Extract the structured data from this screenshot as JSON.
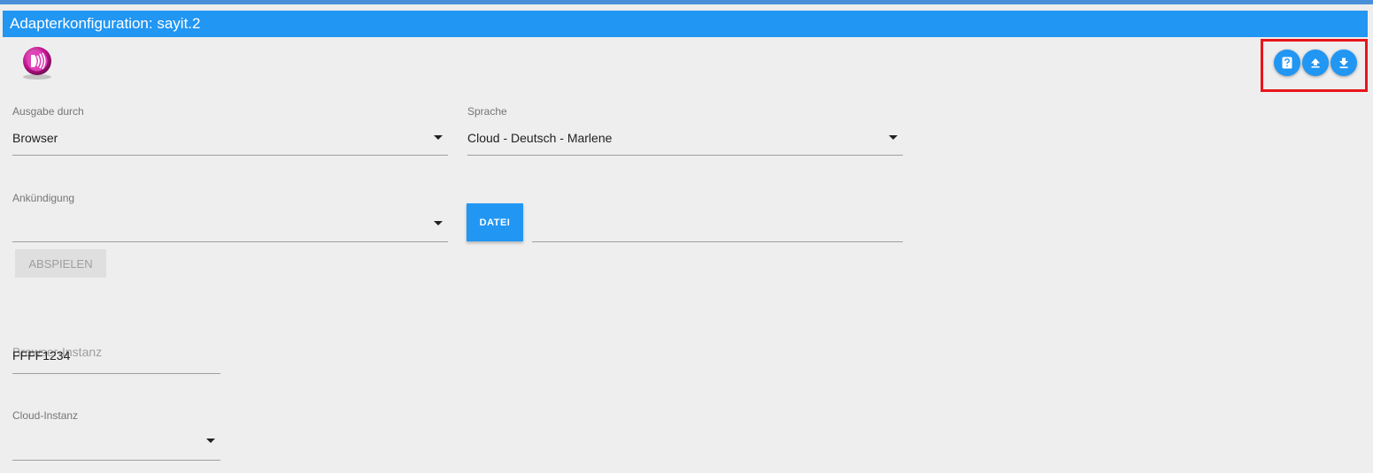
{
  "window": {
    "title": "Adapterkonfiguration: sayit.2"
  },
  "toolbar": {
    "buttons": [
      {
        "icon": "help-icon",
        "label": ""
      },
      {
        "icon": "upload-icon",
        "label": ""
      },
      {
        "icon": "download-icon",
        "label": ""
      }
    ],
    "highlight_color": "#e8151b"
  },
  "form": {
    "output": {
      "label": "Ausgabe durch",
      "value": "Browser"
    },
    "language": {
      "label": "Sprache",
      "value": "Cloud - Deutsch - Marlene"
    },
    "announcement": {
      "label": "Ankündigung",
      "value": "",
      "file_button": "DATEI",
      "file_value": ""
    },
    "play_button": "ABSPIELEN",
    "browser_instance": {
      "label": "Browser-Instanz",
      "value": "FFFF1234"
    },
    "cloud_instance": {
      "label": "Cloud-Instanz",
      "value": ""
    }
  },
  "colors": {
    "accent": "#2196f3",
    "background": "#eeeeee",
    "logo": "#c2188f"
  }
}
